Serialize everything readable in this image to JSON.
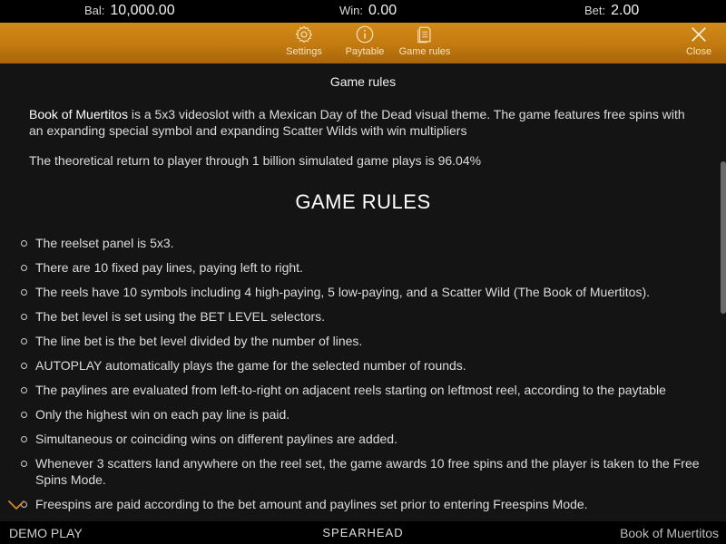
{
  "balance": {
    "label": "Bal:",
    "value": "10,000.00"
  },
  "win": {
    "label": "Win:",
    "value": "0.00"
  },
  "bet": {
    "label": "Bet:",
    "value": "2.00"
  },
  "nav": {
    "settings": {
      "label": "Settings",
      "icon": "gear-icon"
    },
    "paytable": {
      "label": "Paytable",
      "icon": "info-icon"
    },
    "game_rules": {
      "label": "Game rules",
      "icon": "document-icon"
    },
    "close": {
      "label": "Close",
      "icon": "close-icon"
    }
  },
  "content": {
    "section_header": "Game rules",
    "intro_title": "Book of Muertitos",
    "intro_text": " is a 5x3 videoslot with a Mexican Day of the Dead visual theme. The game features free spins with an expanding special symbol and expanding Scatter Wilds with win multipliers",
    "rtp_text": "The theoretical return to player through 1 billion simulated game plays is 96.04%",
    "rules_title": "GAME RULES",
    "rules": [
      "The reelset panel is 5x3.",
      "There are 10 fixed pay lines, paying left to right.",
      "The reels have 10 symbols including 4 high-paying, 5 low-paying, and a Scatter Wild (The Book of Muertitos).",
      "The bet level is set using the BET LEVEL selectors.",
      "The line bet is the bet level divided by the number of lines.",
      "AUTOPLAY automatically plays the game for the selected number of rounds.",
      "The paylines are evaluated from left-to-right on adjacent reels starting on leftmost reel, according to the paytable",
      "Only the highest win on each pay line is paid.",
      "Simultaneous or coinciding wins on different paylines are added.",
      "Whenever 3 scatters land anywhere on the reel set, the game awards 10 free spins and the player is taken to the Free Spins Mode.",
      "Freespins are paid according to the bet amount and paylines set prior to entering Freespins Mode."
    ]
  },
  "footer": {
    "mode": "DEMO PLAY",
    "brand": "SPEARHEAD",
    "game_name": "Book of Muertitos"
  },
  "colors": {
    "nav_orange": "#c27a10",
    "background": "#141414",
    "bar_black": "#000000",
    "chevron": "#d4881a"
  }
}
